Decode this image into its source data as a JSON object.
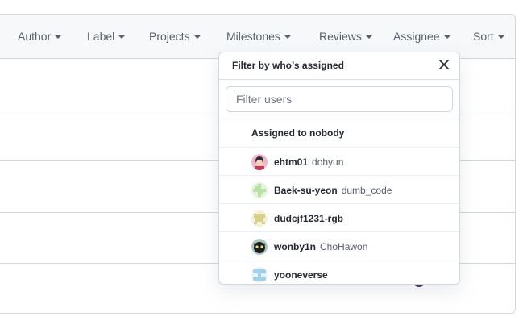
{
  "filters": [
    "Author",
    "Label",
    "Projects",
    "Milestones",
    "Reviews",
    "Assignee",
    "Sort"
  ],
  "menu": {
    "title": "Filter by who’s assigned",
    "close_icon": "x-icon",
    "search_placeholder": "Filter users",
    "nobody_label": "Assigned to nobody",
    "users": [
      {
        "login": "ehtm01",
        "name": "dohyun",
        "avatar_color": "#f2b6c8"
      },
      {
        "login": "Baek-su-yeon",
        "name": "dumb_code",
        "avatar_color": "#b7e2a3"
      },
      {
        "login": "dudcjf1231-rgb",
        "name": "",
        "avatar_color": "#d8cf8a"
      },
      {
        "login": "wonby1n",
        "name": "ChoHawon",
        "avatar_color": "#3a5a4a"
      },
      {
        "login": "yooneverse",
        "name": "",
        "avatar_color": "#9fd2ea"
      }
    ]
  }
}
